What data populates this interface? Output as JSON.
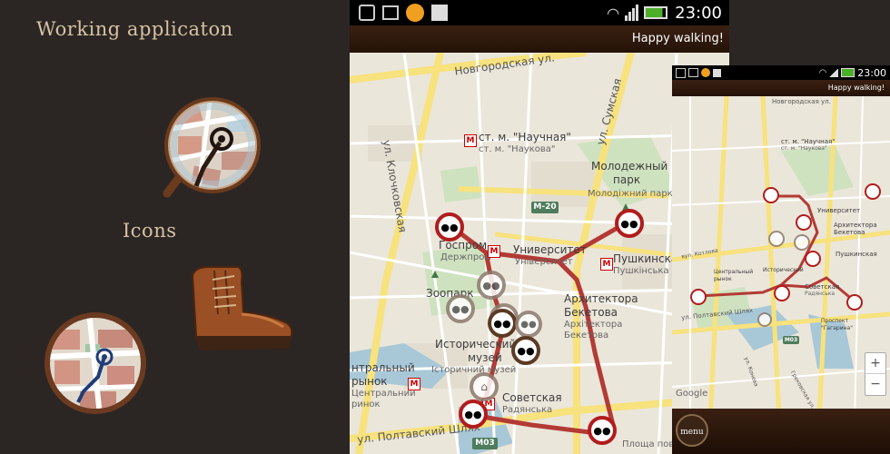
{
  "left": {
    "working_label": "Working applicaton",
    "icons_label": "Icons"
  },
  "phone_large": {
    "status_time": "23:00",
    "header_text": "Happy walking!",
    "labels": {
      "novgorodska": "Новгородская ул.",
      "sumska": "ул. Сумская",
      "klochkovska": "ул. Клочковская",
      "naukova_ru": "ст. м. \"Научная\"",
      "naukova_ua": "ст. м. \"Наукова\"",
      "molodezhny_ru": "Молодежный",
      "park_ru": "парк",
      "molodezhny_ua": "Молодіжний парк",
      "gosprom_ru": "Госпром",
      "derzhprom_ua": "Держпром",
      "universitet_ru": "Университет",
      "universytet_ua": "Університет",
      "pushkinska_ru": "Пушкинская",
      "pushkinska_ua": "Пушкінська",
      "zoopark": "Зоопарк",
      "arkh_ru_1": "Архитектора",
      "arkh_ru_2": "Бекетова",
      "arkh_ua_1": "Архітектора",
      "arkh_ua_2": "Бекетова",
      "ist_ru_1": "Исторический",
      "ist_ru_2": "музей",
      "ist_ua": "Історичний музей",
      "tsentr_ru_1": "нтральный",
      "tsentr_ru_2": "рынок",
      "tsentr_ua_1": "Центральний",
      "tsentr_ua_2": "ринок",
      "sovetska_ru": "Советская",
      "radyanska_ua": "Радянська",
      "poltavsky": "ул. Полтавский Шлях",
      "povstannya": "Площа повстання",
      "m20": "М-20",
      "m03": "М03",
      "metro_letter": "М"
    }
  },
  "phone_small": {
    "status_time": "23:00",
    "header_text": "Happy walking!",
    "google": "Google",
    "menu_button": "menu",
    "zoom_in": "+",
    "zoom_out": "−",
    "labels": {
      "novgorodska": "Новгородская ул.",
      "naukova_ru": "ст. м. \"Научная\"",
      "naukova_ua": "ст. м. \"Наукова\"",
      "universitet": "Университет",
      "arkh": "Архитектора",
      "beketova": "Бекетова",
      "pushkinska": "Пушкинская",
      "sovetska": "Советская",
      "radyanska": "Радянська",
      "tsentralny": "Центральный",
      "rynok": "рынок",
      "istorichny": "Исторический",
      "kotlova": "вул. Котлова",
      "poltavsky": "ул. Полтавский Шлях",
      "prospekt": "Проспект",
      "gagarina": "\"Гагарина\"",
      "m03": "М03",
      "krasnoshkola": "ул. Конева",
      "grekovska": "Грековская ул."
    }
  },
  "colors": {
    "background": "#2b2624",
    "heading": "#d6c2a3",
    "route": "#b33a35",
    "pin_red": "#b11c1c",
    "header_brown": "#2e1a0e"
  }
}
